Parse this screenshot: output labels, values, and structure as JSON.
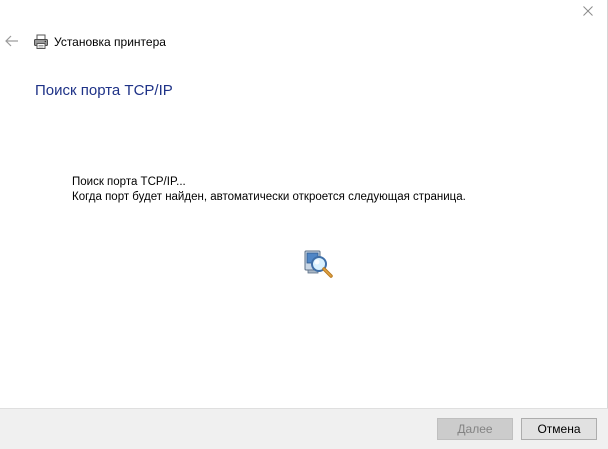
{
  "window": {
    "title": "Установка принтера",
    "close_icon": "close-icon",
    "back_icon": "back-arrow-icon"
  },
  "page": {
    "heading": "Поиск порта TCP/IP",
    "message_line1": "Поиск порта TCP/IP...",
    "message_line2": "Когда порт будет найден, автоматически откроется следующая страница.",
    "status_icon": "search-computer-icon"
  },
  "footer": {
    "next_label": "Далее",
    "next_enabled": false,
    "cancel_label": "Отмена"
  },
  "colors": {
    "heading": "#1e3287",
    "footer_bg": "#f0f0f0",
    "disabled_button_bg": "#cccccc",
    "disabled_button_text": "#838383",
    "button_bg": "#e1e1e1"
  }
}
